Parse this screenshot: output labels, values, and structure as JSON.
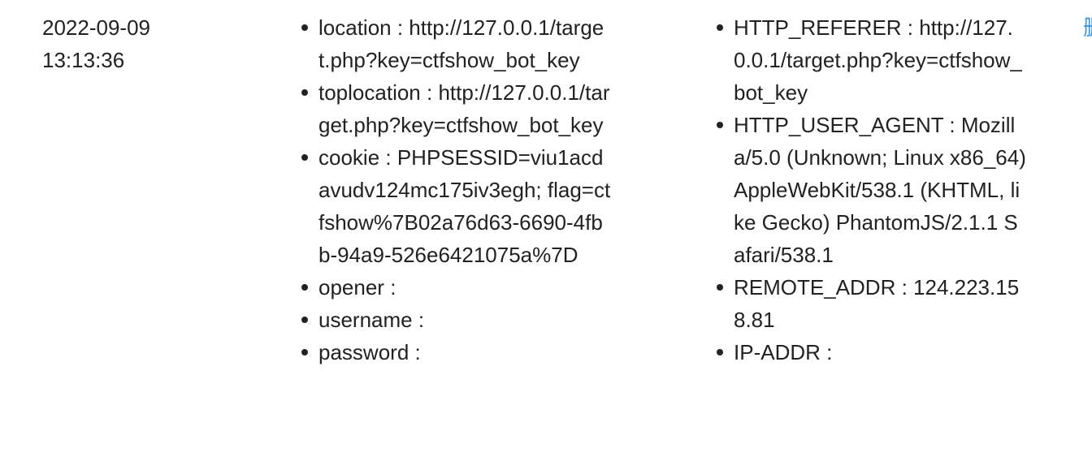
{
  "record": {
    "date": "2022-09-09",
    "time": "13:13:36",
    "client_info": [
      {
        "key": "location",
        "value": "http://127.0.0.1/target.php?key=ctfshow_bot_key"
      },
      {
        "key": "toplocation",
        "value": "http://127.0.0.1/target.php?key=ctfshow_bot_key"
      },
      {
        "key": "cookie",
        "value": "PHPSESSID=viu1acdavudv124mc175iv3egh; flag=ctfshow%7B02a76d63-6690-4fbb-94a9-526e6421075a%7D"
      },
      {
        "key": "opener",
        "value": ""
      },
      {
        "key": "username",
        "value": ""
      },
      {
        "key": "password",
        "value": ""
      }
    ],
    "server_info": [
      {
        "key": "HTTP_REFERER",
        "value": "http://127.0.0.1/target.php?key=ctfshow_bot_key"
      },
      {
        "key": "HTTP_USER_AGENT",
        "value": "Mozilla/5.0 (Unknown; Linux x86_64) AppleWebKit/538.1 (KHTML, like Gecko) PhantomJS/2.1.1 Safari/538.1"
      },
      {
        "key": "REMOTE_ADDR",
        "value": "124.223.158.81"
      },
      {
        "key": "IP-ADDR",
        "value": ""
      }
    ],
    "action_label": "删"
  },
  "colors": {
    "text": "#222222",
    "link": "#3b8fd9",
    "background": "#ffffff"
  }
}
